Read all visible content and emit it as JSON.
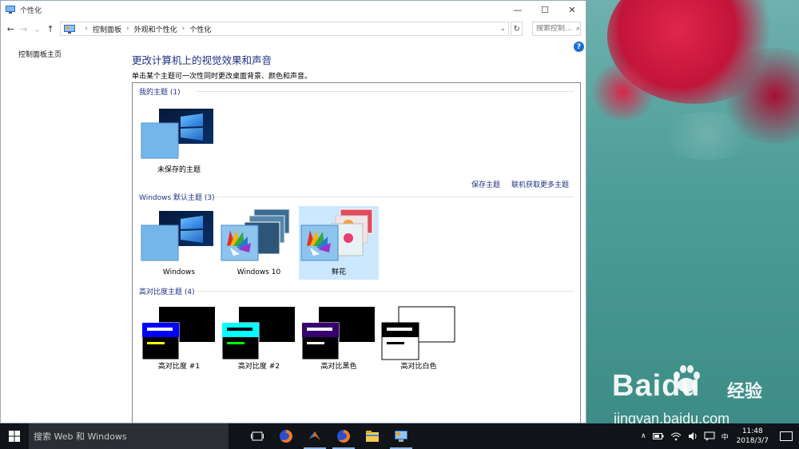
{
  "window": {
    "title": "个性化",
    "min": "—",
    "max": "☐",
    "close": "✕"
  },
  "nav": {
    "back": "←",
    "forward": "→",
    "up": "↑",
    "dropdown": "⌄",
    "refresh": "↻"
  },
  "breadcrumb": [
    "控制面板",
    "外观和个性化",
    "个性化"
  ],
  "breadcrumb_sep": "›",
  "search": {
    "placeholder": "搜索控制...",
    "icon": "⌕"
  },
  "sidebar": {
    "home_link": "控制面板主页"
  },
  "help": "?",
  "heading": "更改计算机上的视觉效果和声音",
  "subheading": "单击某个主题可一次性同时更改桌面背景、颜色和声音。",
  "sections": {
    "my_themes": {
      "title": "我的主题 (1)",
      "items": [
        {
          "label": "未保存的主题"
        }
      ]
    },
    "actions": {
      "save": "保存主题",
      "get_more": "联机获取更多主题"
    },
    "default_themes": {
      "title": "Windows 默认主题 (3)",
      "items": [
        {
          "label": "Windows"
        },
        {
          "label": "Windows 10"
        },
        {
          "label": "鲜花",
          "selected": true
        }
      ]
    },
    "high_contrast": {
      "title": "高对比度主题 (4)",
      "items": [
        {
          "label": "高对比度 #1"
        },
        {
          "label": "高对比度 #2"
        },
        {
          "label": "高对比黑色"
        },
        {
          "label": "高对比白色"
        }
      ]
    }
  },
  "taskbar": {
    "search_text": "搜索 Web 和 Windows",
    "icons": [
      "task-view-icon",
      "firefox-icon",
      "matlab-icon",
      "firefox-icon",
      "file-explorer-icon",
      "control-panel-icon"
    ],
    "tray": {
      "chevron": "∧",
      "ime": "中"
    },
    "time": "11:48",
    "date": "2018/3/7"
  },
  "watermark": {
    "brand": "Baidu",
    "subtitle": "经验",
    "url": "jingyan.baidu.com"
  },
  "colors": {
    "accent": "#1e3287",
    "selection": "#cce8ff",
    "help": "#1c6fd1",
    "taskbar": "#101418"
  }
}
